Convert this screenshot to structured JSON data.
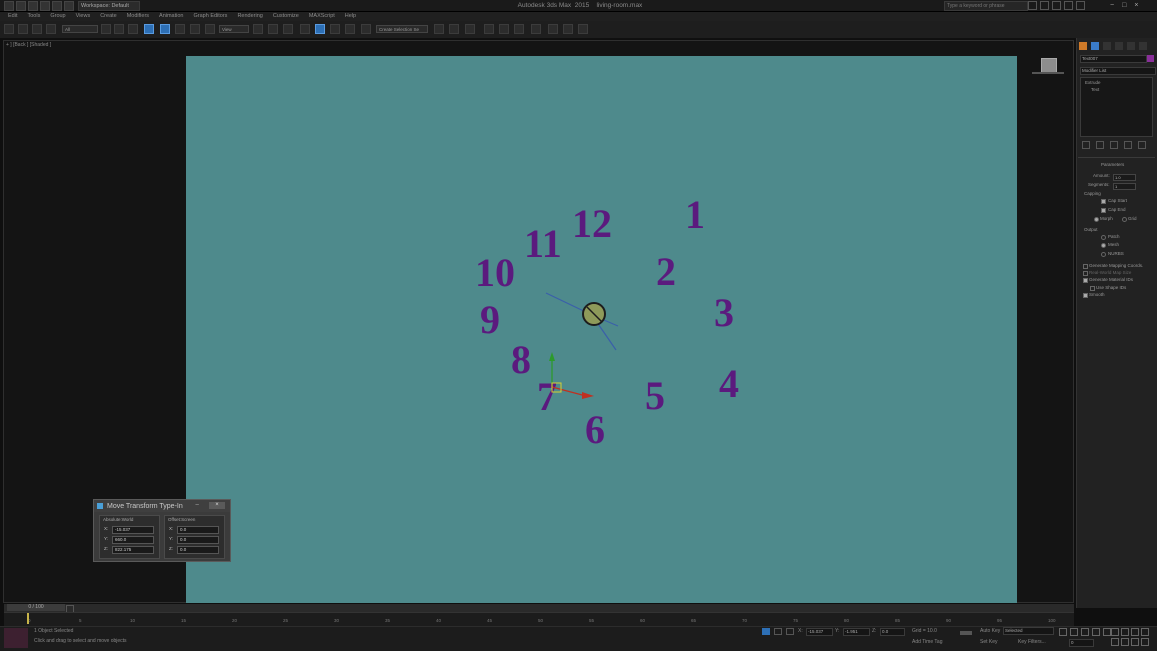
{
  "app": {
    "title": "Autodesk 3ds Max  2015    living-room.max",
    "workspace": "Workspace: Default",
    "search_placeholder": "Type a keyword or phrase",
    "win_controls": [
      "−",
      "□",
      "×"
    ]
  },
  "menu": [
    "Edit",
    "Tools",
    "Group",
    "Views",
    "Create",
    "Modifiers",
    "Animation",
    "Graph Editors",
    "Rendering",
    "Customize",
    "MAXScript",
    "Help"
  ],
  "toolbar": {
    "selection_filter": "All",
    "ref_coord": "View",
    "named_selection": "Create Selection Se"
  },
  "viewport": {
    "label": "+ ] [Back ] [Shaded ]",
    "background_color": "#4e8a8c",
    "clock_numbers": [
      "12",
      "1",
      "2",
      "3",
      "4",
      "5",
      "6",
      "7",
      "8",
      "9",
      "10",
      "11"
    ]
  },
  "dialog": {
    "title": "Move Transform Type-In",
    "abs_group": "Absolute:World",
    "offset_group": "Offset:Screen",
    "abs": [
      {
        "axis": "X:",
        "value": "-15.037"
      },
      {
        "axis": "Y:",
        "value": "660.0"
      },
      {
        "axis": "Z:",
        "value": "822.175"
      }
    ],
    "offset": [
      {
        "axis": "X:",
        "value": "0.0"
      },
      {
        "axis": "Y:",
        "value": "0.0"
      },
      {
        "axis": "Z:",
        "value": "0.0"
      }
    ]
  },
  "command_panel": {
    "object_name": "Text007",
    "modifier_list": "Modifier List",
    "stack": [
      "Extrude",
      "Text"
    ],
    "parameters": "Parameters",
    "amount_label": "Amount:",
    "amount": "1.0",
    "segments_label": "Segments:",
    "segments": "1",
    "capping": "Capping",
    "cap_start": "Cap Start",
    "cap_end": "Cap End",
    "morph": "Morph",
    "grid": "Grid",
    "output": "Output",
    "patch": "Patch",
    "mesh": "Mesh",
    "nurbs": "NURBS",
    "gen_mapping": "Generate Mapping Coords.",
    "real_world": "Real-World Map Size",
    "gen_mat_ids": "Generate Material IDs",
    "use_shape_ids": "Use Shape IDs",
    "smooth": "Smooth"
  },
  "timeline": {
    "frame": "0 / 100",
    "ticks": [
      "0",
      "5",
      "10",
      "15",
      "20",
      "25",
      "30",
      "35",
      "40",
      "45",
      "50",
      "55",
      "60",
      "65",
      "70",
      "75",
      "80",
      "85",
      "90",
      "95",
      "100"
    ]
  },
  "status": {
    "selected": "1 Object Selected",
    "prompt": "Click and drag to select and move objects",
    "x": "-15.037",
    "y": "-1.951",
    "z": "0.0",
    "grid": "Grid = 10.0",
    "auto_key": "Auto Key",
    "set_key": "Set Key",
    "key_mode": "Selected",
    "key_filters": "Key Filters...",
    "add_time_tag": "Add Time Tag",
    "frame_field": "0"
  }
}
